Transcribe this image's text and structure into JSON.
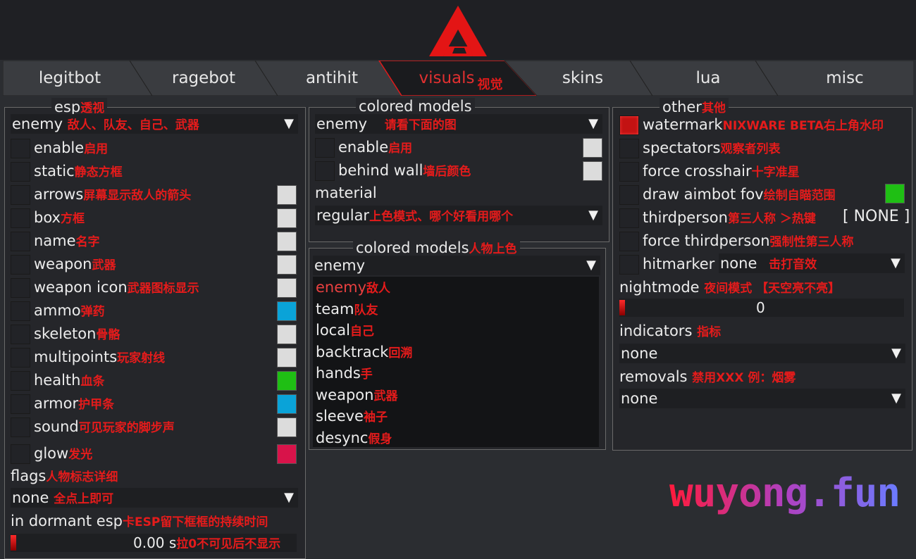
{
  "tabs": [
    {
      "label": "legitbot",
      "cn": ""
    },
    {
      "label": "ragebot",
      "cn": ""
    },
    {
      "label": "antihit",
      "cn": ""
    },
    {
      "label": "visuals",
      "cn": "视觉"
    },
    {
      "label": "skins",
      "cn": ""
    },
    {
      "label": "lua",
      "cn": ""
    },
    {
      "label": "misc",
      "cn": ""
    }
  ],
  "esp": {
    "title": "esp",
    "title_cn": "透视",
    "dropdown": {
      "value": "enemy",
      "cn": "敌人、队友、自己、武器"
    },
    "items": [
      {
        "label": "enable",
        "cn": "启用",
        "color": ""
      },
      {
        "label": "static",
        "cn": "静态方框",
        "color": ""
      },
      {
        "label": "arrows",
        "cn": "屏幕显示敌人的箭头",
        "color": "#dcdcdc"
      },
      {
        "label": "box",
        "cn": "方框",
        "color": "#dcdcdc"
      },
      {
        "label": "name",
        "cn": "名字",
        "color": "#dcdcdc"
      },
      {
        "label": "weapon",
        "cn": "武器",
        "color": "#dcdcdc"
      },
      {
        "label": "weapon icon",
        "cn": "武器图标显示",
        "color": "#dcdcdc"
      },
      {
        "label": "ammo",
        "cn": "弹药",
        "color": "#0aa3d8"
      },
      {
        "label": "skeleton",
        "cn": "骨骼",
        "color": "#dcdcdc"
      },
      {
        "label": "multipoints",
        "cn": "玩家射线",
        "color": "#dcdcdc"
      },
      {
        "label": "health",
        "cn": "血条",
        "color": "#1fbf14"
      },
      {
        "label": "armor",
        "cn": "护甲条",
        "color": "#0aa3d8"
      },
      {
        "label": "sound",
        "cn": "可见玩家的脚步声",
        "color": "#dcdcdc"
      },
      {
        "label": "glow",
        "cn": "发光",
        "color": "#d8134a"
      }
    ],
    "flags": {
      "label": "flags",
      "cn": "人物标志详细"
    },
    "flags_dropdown": {
      "value": "none",
      "cn": "全点上即可"
    },
    "dormant": {
      "label": "in dormant esp",
      "cn": "卡ESP留下框框的持续时间"
    },
    "dormant_slider": {
      "value": "0.00 s",
      "cn": "拉0不可见后不显示",
      "fraction": 0
    }
  },
  "colored1": {
    "title": "colored models",
    "dropdown": {
      "value": "enemy",
      "cn": "请看下面的图"
    },
    "items": [
      {
        "label": "enable",
        "cn": "启用",
        "color": "#dcdcdc"
      },
      {
        "label": "behind wall",
        "cn": "墙后颜色",
        "color": "#dcdcdc"
      }
    ],
    "material": "material",
    "material_dropdown": {
      "value": "regular",
      "cn": "上色模式、哪个好看用哪个"
    }
  },
  "colored2": {
    "title": "colored models",
    "title_cn": "人物上色",
    "dropdown": {
      "value": "enemy"
    },
    "list": [
      {
        "label": "enemy",
        "cn": "敌人"
      },
      {
        "label": "team",
        "cn": "队友"
      },
      {
        "label": "local",
        "cn": "自己"
      },
      {
        "label": "backtrack",
        "cn": "回溯"
      },
      {
        "label": "hands",
        "cn": "手"
      },
      {
        "label": "weapon",
        "cn": "武器"
      },
      {
        "label": "sleeve",
        "cn": "袖子"
      },
      {
        "label": "desync",
        "cn": "假身"
      }
    ]
  },
  "other": {
    "title": "other",
    "title_cn": "其他",
    "items": [
      {
        "label": "watermark",
        "cn": "NIXWARE BETA右上角水印",
        "checked": true
      },
      {
        "label": "spectators",
        "cn": "观察者列表",
        "checked": false
      },
      {
        "label": "force crosshair",
        "cn": "十字准星",
        "checked": false
      },
      {
        "label": "draw aimbot fov",
        "cn": "绘制自瞄范围",
        "checked": false
      },
      {
        "label": "thirdperson",
        "cn": "第三人称 ＞热键",
        "checked": false
      },
      {
        "label": "force thirdperson",
        "cn": "强制性第三人称",
        "checked": false
      },
      {
        "label": "hitmarker",
        "cn": "",
        "checked": false
      }
    ],
    "fov_color": "#1fbf14",
    "hotkey": "[ NONE ]",
    "hitmarker_value": "none",
    "hitmarker_cn": "击打音效",
    "nightmode": {
      "label": "nightmode",
      "cn": "夜间模式 【天空亮不亮】"
    },
    "nightmode_slider": {
      "value": "0",
      "fraction": 0
    },
    "indicators": {
      "label": "indicators",
      "cn": "指标"
    },
    "indicators_dropdown": "none",
    "removals": {
      "label": "removals",
      "cn": "禁用XXX 例：烟雾"
    },
    "removals_dropdown": "none"
  },
  "watermark_text": "wuyong.fun",
  "colors": {
    "accent": "#e51b1b",
    "bg": "#25262a"
  }
}
